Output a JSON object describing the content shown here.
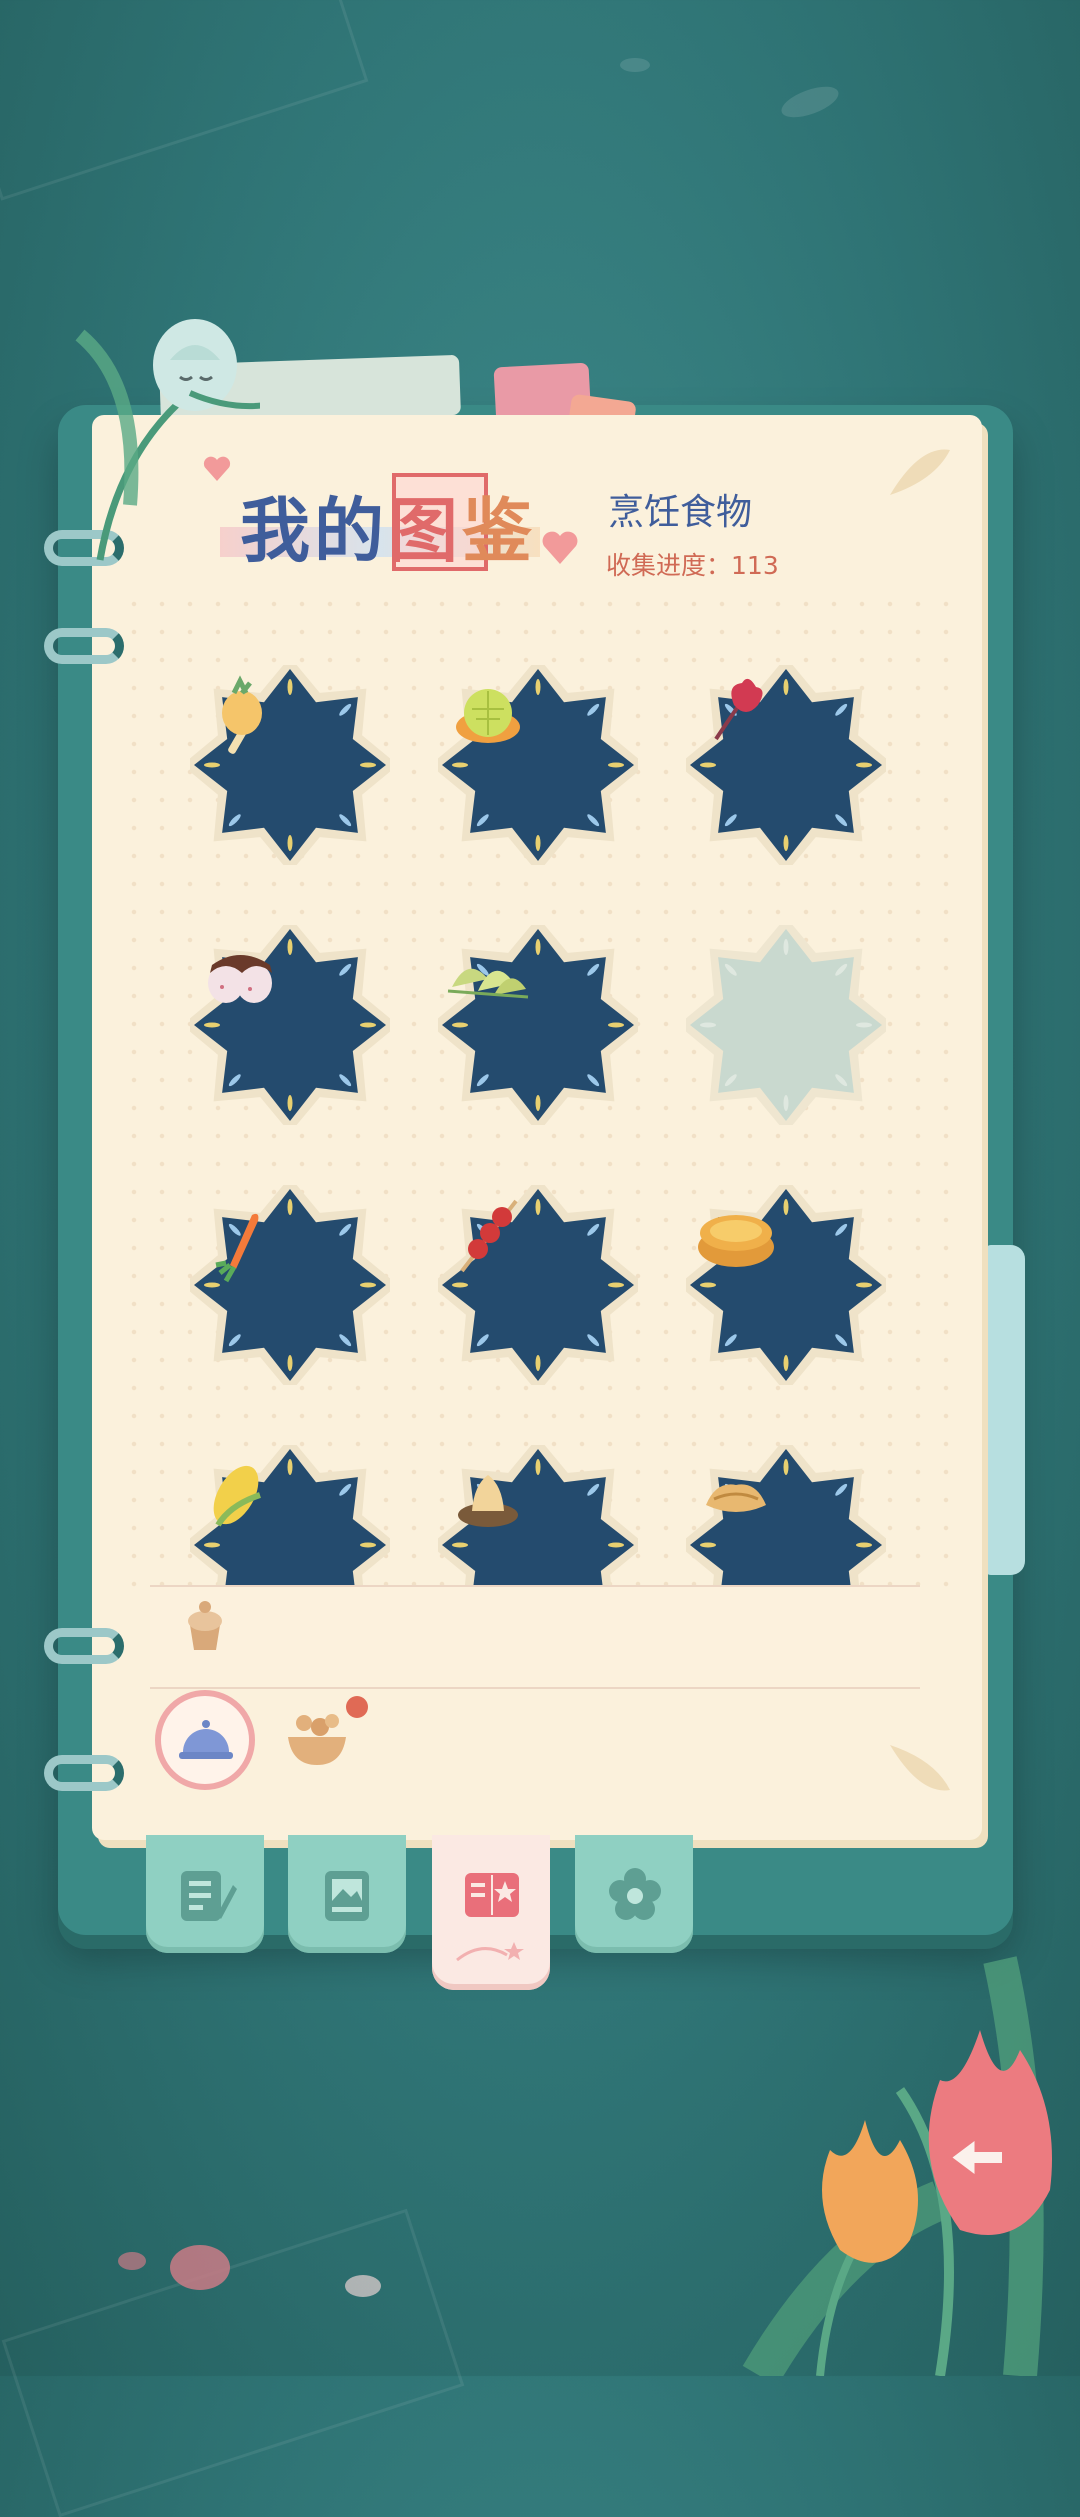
{
  "header": {
    "title_part1": "我的",
    "title_part2": "图",
    "title_part3": "鉴",
    "category": "烹饪食物",
    "progress_label": "收集进度：",
    "progress_value": "113"
  },
  "grid": {
    "items": [
      {
        "name": "pineapple-popsicle",
        "icon": "pineapple-popsicle-icon",
        "collected": true
      },
      {
        "name": "melon-tart",
        "icon": "melon-tart-icon",
        "collected": true
      },
      {
        "name": "red-flower-dish",
        "icon": "red-flower-icon",
        "collected": true
      },
      {
        "name": "chocolate-strawberry",
        "icon": "chocolate-strawberry-icon",
        "collected": true
      },
      {
        "name": "dumplings",
        "icon": "dumplings-icon",
        "collected": true
      },
      {
        "name": "locked-slot",
        "icon": "locked-icon",
        "collected": false
      },
      {
        "name": "carrot",
        "icon": "carrot-icon",
        "collected": true
      },
      {
        "name": "candied-hawthorn-skewer",
        "icon": "skewer-icon",
        "collected": true
      },
      {
        "name": "egg-tart",
        "icon": "egg-tart-icon",
        "collected": true
      },
      {
        "name": "corn",
        "icon": "corn-icon",
        "collected": true
      },
      {
        "name": "garlic-dish",
        "icon": "garlic-icon",
        "collected": true
      },
      {
        "name": "bread-dish",
        "icon": "bread-icon",
        "collected": true
      }
    ]
  },
  "category_tabs": [
    {
      "icon": "cupcake-icon"
    },
    {
      "icon": "cloche-icon",
      "active": true
    },
    {
      "icon": "food-bowl-icon",
      "has_notification": true
    }
  ],
  "book_tabs": [
    {
      "icon": "notes-icon"
    },
    {
      "icon": "photo-album-icon"
    },
    {
      "icon": "collection-book-icon",
      "active": true
    },
    {
      "icon": "flower-icon"
    }
  ],
  "colors": {
    "background": "#2f7475",
    "page": "#fbf1dc",
    "slot_fill": "#244b6e",
    "title_blue": "#3f5d9b",
    "accent_red": "#e06a6a",
    "tab_green": "#8fd0c2"
  }
}
